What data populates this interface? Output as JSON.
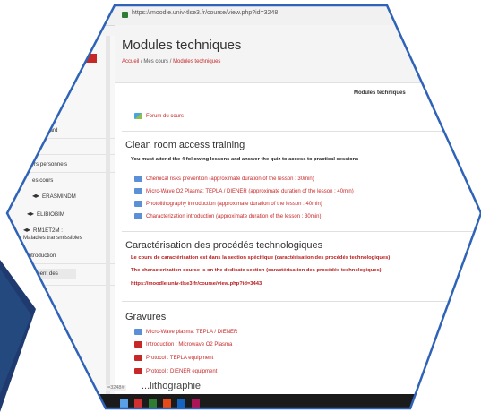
{
  "browser": {
    "url": "https://moodle.univ-tlse3.fr/course/view.php?id=3248"
  },
  "menu_fragment": "es ▾",
  "course": {
    "title": "Modules techniques",
    "breadcrumb": {
      "home": "Accueil",
      "sep1": "/",
      "mine": "Mes cours",
      "sep2": "/",
      "current": "Modules techniques"
    },
    "heading": "Modules techniques",
    "forum": "Forum du cours"
  },
  "sidebar": {
    "items": [
      {
        "label": "oard",
        "icon": ""
      },
      {
        "label": "e",
        "icon": ""
      },
      {
        "label": "rs personnels",
        "icon": ""
      },
      {
        "label": "es cours",
        "icon": ""
      },
      {
        "label": "ERASMINDM",
        "icon": "graduation-cap-icon"
      },
      {
        "label": "ELIBIOBIM",
        "icon": "graduation-cap-icon"
      },
      {
        "label": "RM1ET2M : Maladies transmissibles",
        "icon": "graduation-cap-icon"
      },
      {
        "label": "Introduction",
        "icon": ""
      },
      {
        "label": "ement des",
        "icon": ""
      },
      {
        "label": "ques",
        "icon": ""
      },
      {
        "label": "nes",
        "icon": ""
      }
    ]
  },
  "sections": [
    {
      "title": "Clean room access training",
      "notes": [
        "You must attend the 4 following lessons and answer the quiz to access to practical sessions"
      ],
      "activities": [
        {
          "label": "Chemical risks prevention (approximate duration of the lesson : 30min)",
          "icon": "lesson-icon"
        },
        {
          "label": "Micro-Wave O2 Plasma: TEPLA / DIENER (approximate duration of the lesson : 40min)",
          "icon": "lesson-icon"
        },
        {
          "label": "Photolithography introduction (approximate duration of the lesson : 40min)",
          "icon": "lesson-icon"
        },
        {
          "label": "Characterization introduction (approximate duration of the lesson : 30min)",
          "icon": "lesson-icon"
        }
      ]
    },
    {
      "title": "Caractérisation des procédés technologiques",
      "notes": [
        "Le cours de caractérisation est dans la section spécifique (caractérisation des procédés technologiques)",
        "The characterization course is on the dedicate section (caractérisation des procédés technologiques)",
        "https://moodle.univ-tlse3.fr/course/view.php?id=3443"
      ]
    },
    {
      "title": "Gravures",
      "activities": [
        {
          "label": "Micro-Wave plasma: TEPLA / DIENER",
          "icon": "lesson-icon"
        },
        {
          "label": "Introduction : Microwave O2 Plasma",
          "icon": "pdf-icon"
        },
        {
          "label": "Protocol : TEPLA equipment",
          "icon": "pdf-icon"
        },
        {
          "label": "Protocol : DIENER equipment",
          "icon": "pdf-icon"
        }
      ]
    },
    {
      "title": "...lithographie"
    }
  ],
  "status_url": "=3248#",
  "colors": {
    "accent": "#c62828",
    "hex_frame": "#2f63b8",
    "hex_dark": "#1e3a6e",
    "taskbar": "#1b1b1b"
  }
}
